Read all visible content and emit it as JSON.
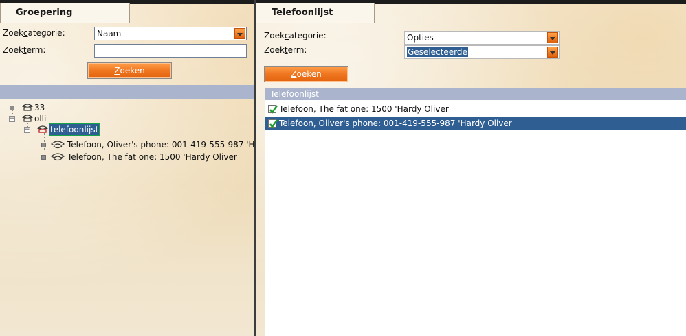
{
  "left": {
    "tab": "Groepering",
    "category_label_pre": "Zoek",
    "category_label_ul": "c",
    "category_label_post": "ategorie:",
    "category_value": "Naam",
    "term_label_pre": "Zoek",
    "term_label_ul": "t",
    "term_label_post": "erm:",
    "term_value": "",
    "search_button_ul": "Z",
    "search_button_post": "oeken",
    "tree": [
      {
        "label": "33"
      },
      {
        "label": "olli"
      },
      {
        "label": "telefoonlijst"
      },
      {
        "label": "Telefoon, Oliver's phone: 001-419-555-987 'Hardy Oliver"
      },
      {
        "label": "Telefoon, The fat one: 1500 'Hardy Oliver"
      }
    ]
  },
  "right": {
    "tab": "Telefoonlijst",
    "category_label_pre": "Zoek",
    "category_label_ul": "c",
    "category_label_post": "ategorie:",
    "category_value": "Opties",
    "term_label_pre": "Zoek",
    "term_label_ul": "t",
    "term_label_post": "erm:",
    "term_value": "Geselecteerde",
    "search_button_ul": "Z",
    "search_button_post": "oeken",
    "list_header": "Telefoonlijst",
    "list_items": [
      {
        "text": "Telefoon, The fat one: 1500 'Hardy Oliver",
        "checked": true,
        "selected": false
      },
      {
        "text": "Telefoon, Oliver's phone: 001-419-555-987 'Hardy Oliver",
        "checked": true,
        "selected": true
      }
    ]
  },
  "colors": {
    "accent_orange": "#f07620",
    "selection_blue": "#2f5e93",
    "header_band": "#aab4cc",
    "checkmark_green": "#1f9d2e"
  }
}
